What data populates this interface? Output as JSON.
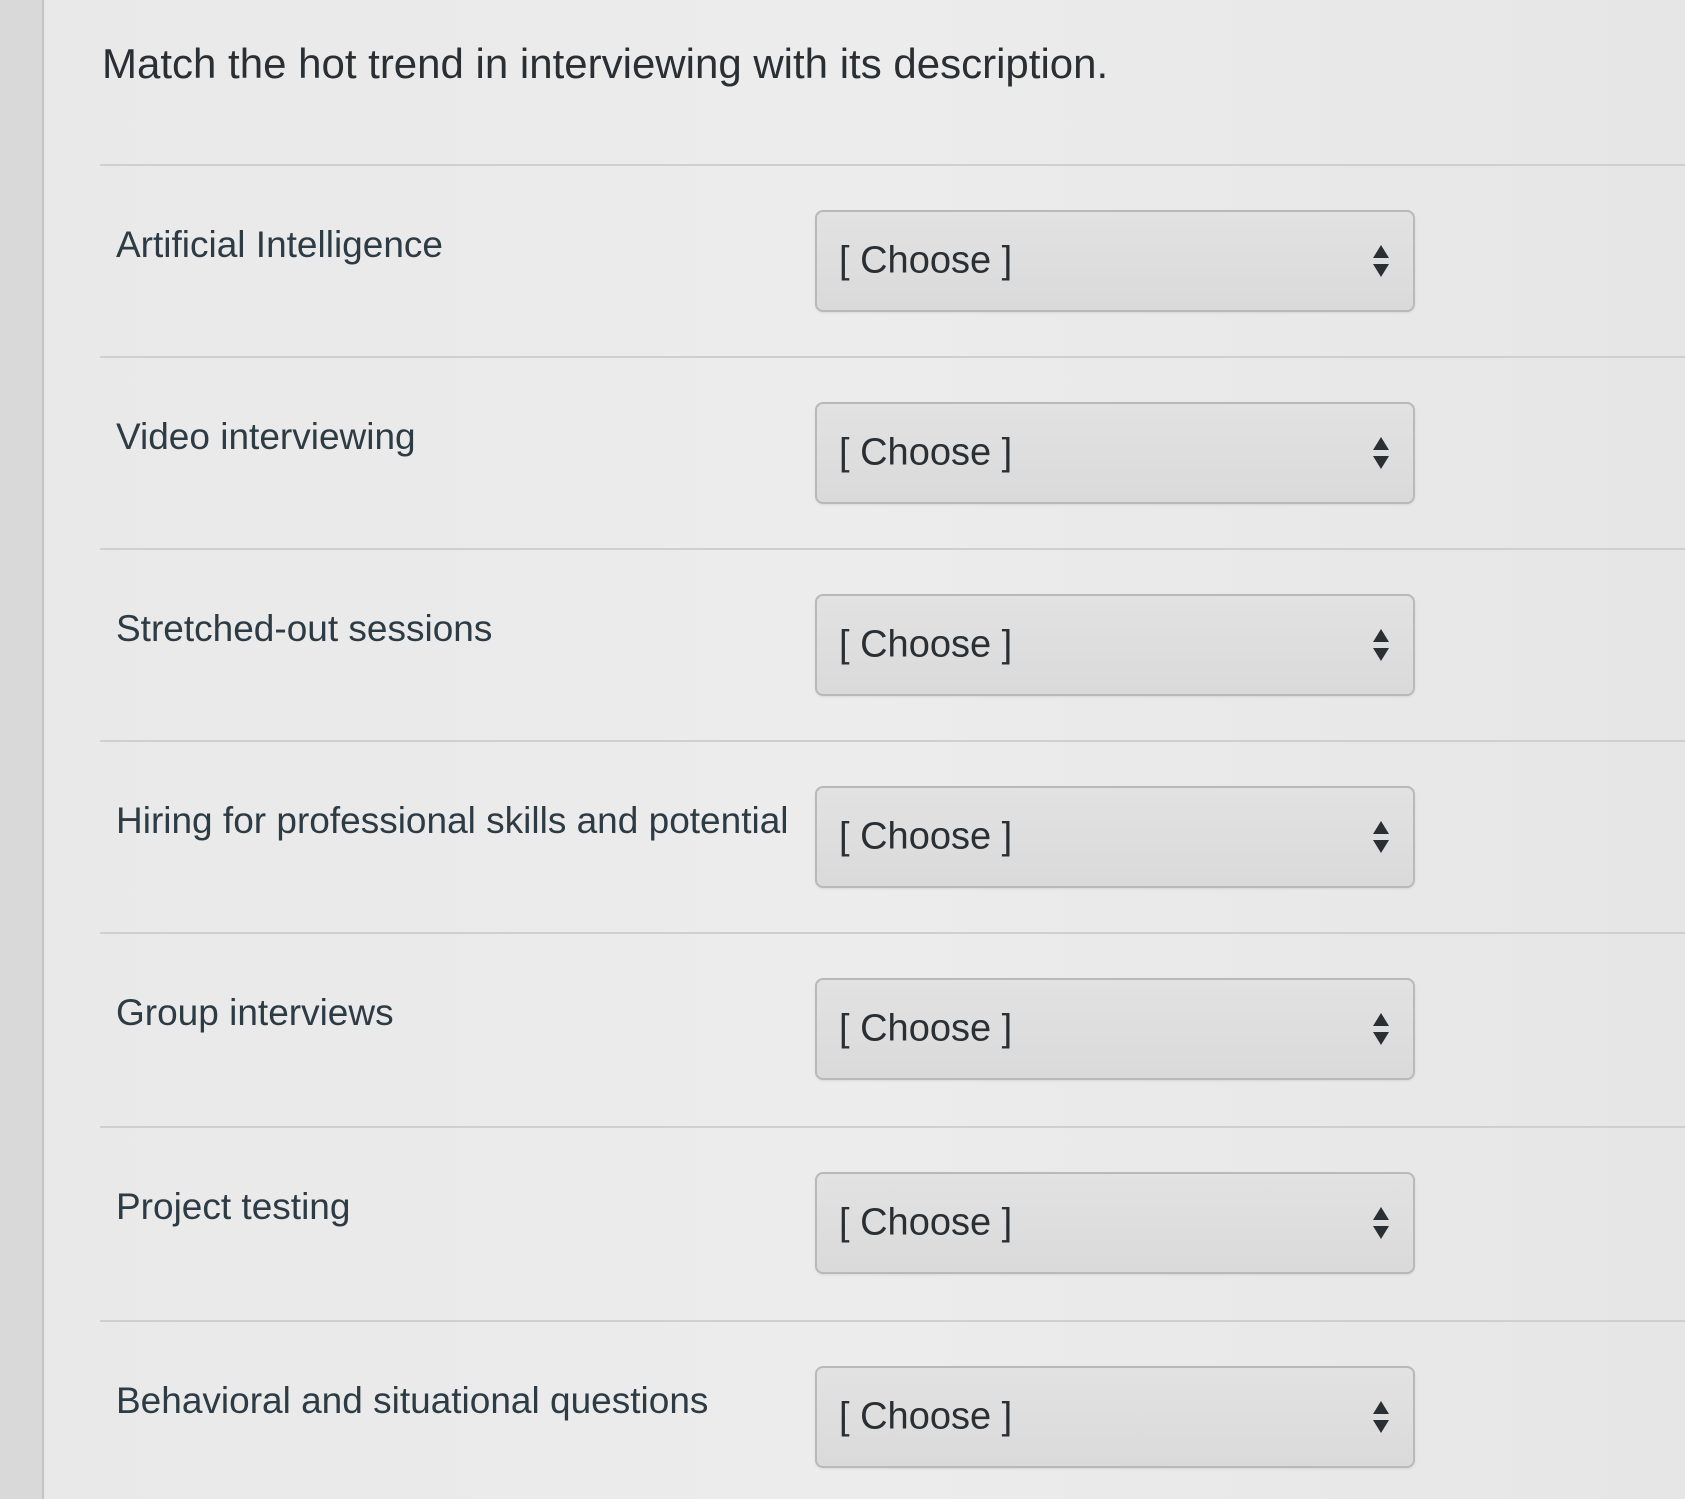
{
  "question": {
    "title": "Match the hot trend in interviewing with its description."
  },
  "rows": [
    {
      "label": "Artificial Intelligence",
      "selected": "[ Choose ]"
    },
    {
      "label": "Video interviewing",
      "selected": "[ Choose ]"
    },
    {
      "label": "Stretched-out sessions",
      "selected": "[ Choose ]"
    },
    {
      "label": "Hiring for professional skills and potential",
      "selected": "[ Choose ]"
    },
    {
      "label": "Group interviews",
      "selected": "[ Choose ]"
    },
    {
      "label": "Project testing",
      "selected": "[ Choose ]"
    },
    {
      "label": "Behavioral and situational questions",
      "selected": "[ Choose ]"
    }
  ],
  "icons": {
    "dropdown": "up-down-arrows-icon"
  },
  "colors": {
    "background": "#ebebeb",
    "text": "#2d3b45",
    "select_background": "#dedede",
    "select_border": "#b9b9b9",
    "divider": "#cfcfcf"
  }
}
